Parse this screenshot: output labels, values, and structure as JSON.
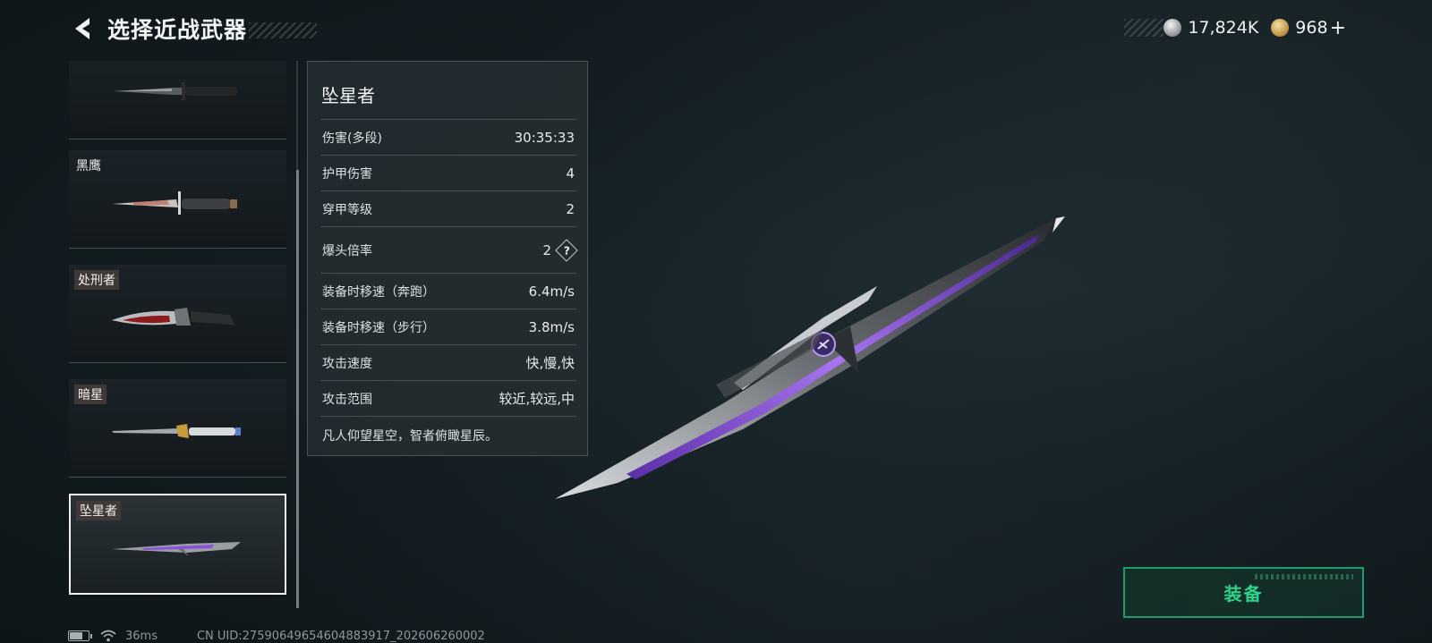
{
  "header": {
    "title": "选择近战武器"
  },
  "currency": {
    "silver_value": "17,824K",
    "gold_value": "968",
    "plus_label": "+"
  },
  "weapons": [
    {
      "name": "",
      "selected": false
    },
    {
      "name": "黑鹰",
      "selected": false
    },
    {
      "name": "处刑者",
      "selected": false
    },
    {
      "name": "暗星",
      "selected": false
    },
    {
      "name": "坠星者",
      "selected": true
    }
  ],
  "details": {
    "name": "坠星者",
    "stats": [
      {
        "label": "伤害(多段)",
        "value": "30:35:33"
      },
      {
        "label": "护甲伤害",
        "value": "4"
      },
      {
        "label": "穿甲等级",
        "value": "2"
      },
      {
        "label": "爆头倍率",
        "value": "2",
        "help": "?"
      },
      {
        "label": "装备时移速（奔跑）",
        "value": "6.4m/s"
      },
      {
        "label": "装备时移速（步行）",
        "value": "3.8m/s"
      },
      {
        "label": "攻击速度",
        "value": "快,慢,快"
      },
      {
        "label": "攻击范围",
        "value": "较近,较远,中"
      }
    ],
    "description": "凡人仰望星空，智者俯瞰星辰。"
  },
  "equip_button": {
    "label": "装备"
  },
  "footer": {
    "battery_level": 0.7,
    "ping": "36ms",
    "uid": "CN UID:2759064965460488391​7_202606260002"
  },
  "colors": {
    "accent_green": "#2fd48c",
    "equip_border": "#1e9c6a",
    "weapon_purple": "#8a4fe0"
  }
}
